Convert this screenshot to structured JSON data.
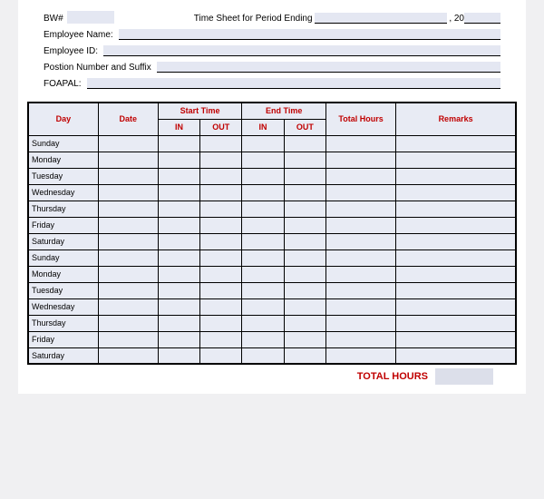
{
  "header": {
    "bw_label": "BW#",
    "bw_value": "",
    "title_prefix": "Time Sheet for Period Ending",
    "period_value": "",
    "year_prefix": ", 20",
    "year_value": "",
    "employee_name_label": "Employee Name:",
    "employee_name_value": "",
    "employee_id_label": "Employee ID:",
    "employee_id_value": "",
    "position_label": "Postion Number and Suffix",
    "position_value": "",
    "foapal_label": "FOAPAL:",
    "foapal_value": ""
  },
  "columns": {
    "day": "Day",
    "date": "Date",
    "start_time": "Start Time",
    "end_time": "End Time",
    "in": "IN",
    "out": "OUT",
    "total_hours": "Total Hours",
    "remarks": "Remarks"
  },
  "rows": [
    {
      "day": "Sunday",
      "date": "",
      "start_in": "",
      "start_out": "",
      "end_in": "",
      "end_out": "",
      "total": "",
      "remarks": ""
    },
    {
      "day": "Monday",
      "date": "",
      "start_in": "",
      "start_out": "",
      "end_in": "",
      "end_out": "",
      "total": "",
      "remarks": ""
    },
    {
      "day": "Tuesday",
      "date": "",
      "start_in": "",
      "start_out": "",
      "end_in": "",
      "end_out": "",
      "total": "",
      "remarks": ""
    },
    {
      "day": "Wednesday",
      "date": "",
      "start_in": "",
      "start_out": "",
      "end_in": "",
      "end_out": "",
      "total": "",
      "remarks": ""
    },
    {
      "day": "Thursday",
      "date": "",
      "start_in": "",
      "start_out": "",
      "end_in": "",
      "end_out": "",
      "total": "",
      "remarks": ""
    },
    {
      "day": "Friday",
      "date": "",
      "start_in": "",
      "start_out": "",
      "end_in": "",
      "end_out": "",
      "total": "",
      "remarks": ""
    },
    {
      "day": "Saturday",
      "date": "",
      "start_in": "",
      "start_out": "",
      "end_in": "",
      "end_out": "",
      "total": "",
      "remarks": ""
    },
    {
      "day": "Sunday",
      "date": "",
      "start_in": "",
      "start_out": "",
      "end_in": "",
      "end_out": "",
      "total": "",
      "remarks": ""
    },
    {
      "day": "Monday",
      "date": "",
      "start_in": "",
      "start_out": "",
      "end_in": "",
      "end_out": "",
      "total": "",
      "remarks": ""
    },
    {
      "day": "Tuesday",
      "date": "",
      "start_in": "",
      "start_out": "",
      "end_in": "",
      "end_out": "",
      "total": "",
      "remarks": ""
    },
    {
      "day": "Wednesday",
      "date": "",
      "start_in": "",
      "start_out": "",
      "end_in": "",
      "end_out": "",
      "total": "",
      "remarks": ""
    },
    {
      "day": "Thursday",
      "date": "",
      "start_in": "",
      "start_out": "",
      "end_in": "",
      "end_out": "",
      "total": "",
      "remarks": ""
    },
    {
      "day": "Friday",
      "date": "",
      "start_in": "",
      "start_out": "",
      "end_in": "",
      "end_out": "",
      "total": "",
      "remarks": ""
    },
    {
      "day": "Saturday",
      "date": "",
      "start_in": "",
      "start_out": "",
      "end_in": "",
      "end_out": "",
      "total": "",
      "remarks": ""
    }
  ],
  "footer": {
    "total_hours_label": "TOTAL HOURS",
    "total_hours_value": ""
  }
}
